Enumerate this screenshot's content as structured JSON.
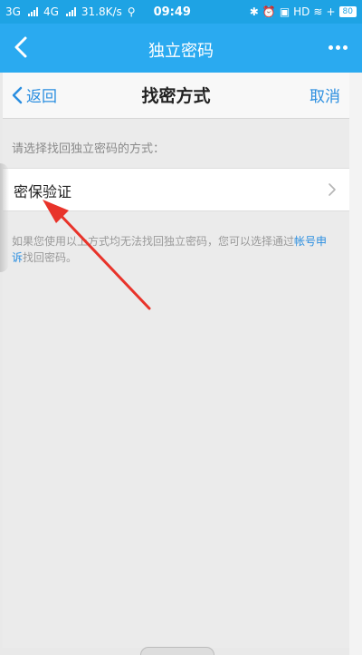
{
  "status_bar": {
    "network1": "3G",
    "network2": "4G",
    "speed": "31.8K/s",
    "time": "09:49",
    "hd": "HD",
    "battery": "80"
  },
  "app_bar": {
    "title": "独立密码"
  },
  "web": {
    "back_label": "返回",
    "title": "找密方式",
    "cancel_label": "取消",
    "prompt": "请选择找回独立密码的方式：",
    "options": [
      {
        "label": "密保验证"
      }
    ],
    "note_text": "如果您使用以上方式均无法找回独立密码，您可以选择通过",
    "note_link": "帐号申诉",
    "note_tail": "找回密码。"
  },
  "colors": {
    "accent": "#2aaaf0",
    "link": "#2a8ee0",
    "annotation_arrow": "#e8332a"
  }
}
